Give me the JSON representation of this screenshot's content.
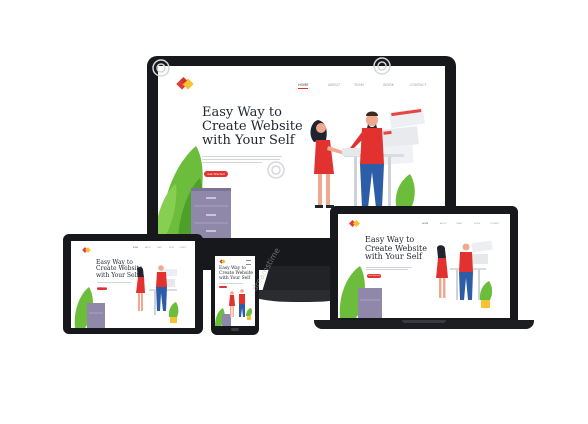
{
  "hero": {
    "title_lines": [
      "Easy Way to",
      "Create Website",
      "with Your Self"
    ],
    "cta_label": "Get Started"
  },
  "nav": [
    "HOME",
    "ABOUT",
    "TEAM",
    "WORK",
    "CONTACT"
  ],
  "watermark": "dreamstime",
  "colors": {
    "bezel": "#17181b",
    "accent_red": "#e2322f",
    "logo_red": "#e23b37",
    "logo_yellow": "#f4c430",
    "plant_green": "#6cbd3b",
    "cabinet_purple": "#8f88a8",
    "skin": "#f0a98e"
  },
  "icons": [
    "logo-icon",
    "plant-icon",
    "cabinet-icon",
    "woman-figure-icon",
    "man-figure-icon",
    "browser-window-icon",
    "watermark-swirl-icon"
  ]
}
